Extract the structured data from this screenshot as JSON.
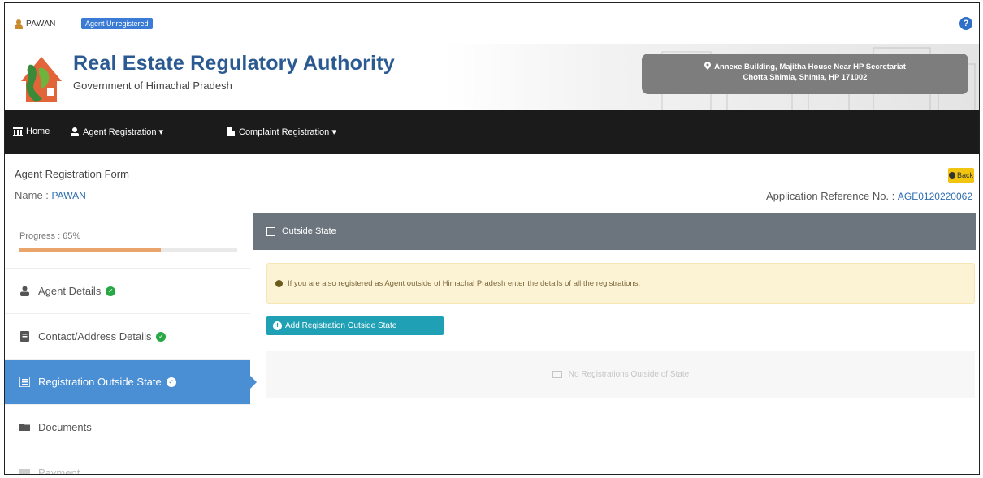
{
  "topbar": {
    "username": "PAWAN",
    "role_badge": "Agent Unregistered"
  },
  "header": {
    "org_title": "Real Estate Regulatory Authority",
    "org_subtitle": "Government of Himachal Pradesh",
    "address_line1": "Annexe Building, Majitha House Near HP Secretariat",
    "address_line2": "Chotta Shimla, Shimla, HP 171002"
  },
  "navbar": {
    "home": "Home",
    "agent_registration": "Agent Registration ▾",
    "complaint_registration": "Complaint Registration ▾"
  },
  "form": {
    "title": "Agent Registration Form",
    "name_label": "Name :",
    "name_value": "PAWAN",
    "back_label": "Back",
    "app_ref_label": "Application Reference No. :",
    "app_ref_value": "AGE0120220062"
  },
  "sidebar": {
    "progress_label": "Progress : 65%",
    "progress_value": 0.65,
    "items": [
      {
        "label": "Agent Details",
        "checked": true
      },
      {
        "label": "Contact/Address Details",
        "checked": true
      },
      {
        "label": "Registration Outside State",
        "checked": true
      },
      {
        "label": "Documents",
        "checked": false
      },
      {
        "label": "Payment",
        "checked": false
      }
    ]
  },
  "main": {
    "panel_title": "Outside State",
    "alert_text": "If you are also registered as Agent outside of Himachal Pradesh enter the details of all the registrations.",
    "add_button": "Add Registration Outside State",
    "empty_text": "No Registrations Outside of State"
  },
  "colors": {
    "brand_blue": "#2b5a93",
    "nav_bg": "#1b1b1b",
    "active_item": "#4a8ed3",
    "panel_head": "#6c757d",
    "teal_button": "#1fa0b5",
    "progress_fill": "#e9a46b"
  }
}
